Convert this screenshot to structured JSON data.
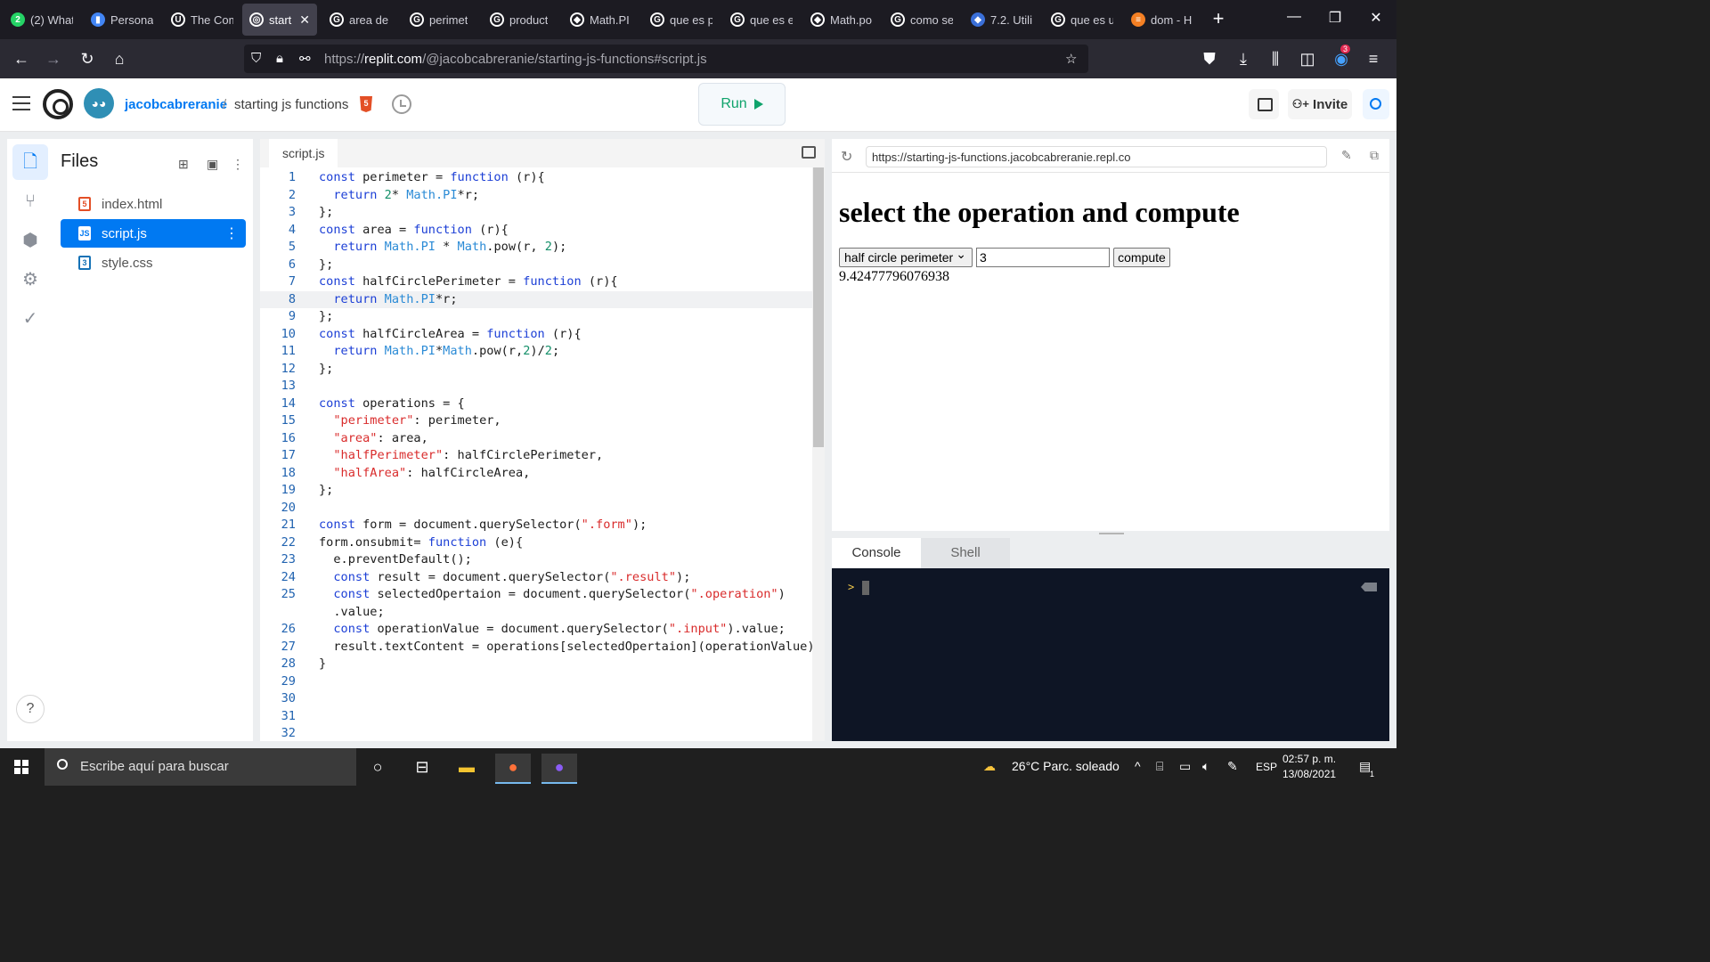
{
  "browser": {
    "tabs": [
      {
        "title": "(2) What",
        "icon": "whatsapp-icon",
        "color": "#25d366",
        "glyph": "2"
      },
      {
        "title": "Personal",
        "icon": "chart-bars-icon",
        "color": "#4285f4",
        "glyph": "▮"
      },
      {
        "title": "The Com",
        "icon": "u-logo-icon",
        "color": "#ffffff",
        "glyph": "U"
      },
      {
        "title": "startin",
        "icon": "replit-icon",
        "color": "#ffffff",
        "glyph": "◎"
      },
      {
        "title": "area de",
        "icon": "google-icon",
        "color": "#ffffff",
        "glyph": "G"
      },
      {
        "title": "perimet",
        "icon": "google-icon",
        "color": "#ffffff",
        "glyph": "G"
      },
      {
        "title": "product",
        "icon": "google-icon",
        "color": "#ffffff",
        "glyph": "G"
      },
      {
        "title": "Math.PI",
        "icon": "mdn-icon",
        "color": "#ffffff",
        "glyph": "◆"
      },
      {
        "title": "que es p",
        "icon": "google-icon",
        "color": "#ffffff",
        "glyph": "G"
      },
      {
        "title": "que es e",
        "icon": "google-icon",
        "color": "#ffffff",
        "glyph": "G"
      },
      {
        "title": "Math.po",
        "icon": "mdn-icon",
        "color": "#ffffff",
        "glyph": "◆"
      },
      {
        "title": "como se",
        "icon": "google-icon",
        "color": "#ffffff",
        "glyph": "G"
      },
      {
        "title": "7.2. Utili",
        "icon": "diamond-icon",
        "color": "#3a6fd8",
        "glyph": "◆"
      },
      {
        "title": "que es u",
        "icon": "google-icon",
        "color": "#ffffff",
        "glyph": "G"
      },
      {
        "title": "dom - H",
        "icon": "stackoverflow-icon",
        "color": "#f48024",
        "glyph": "≡"
      }
    ],
    "url_prefix": "https://",
    "url_host": "replit.com",
    "url_path": "/@jacobcabreranie/starting-js-functions#script.js",
    "notification_count": "3"
  },
  "replit": {
    "username": "jacobcabreranie",
    "separator": "/",
    "repl_name": "starting js functions",
    "run_label": "Run",
    "invite_label": "Invite",
    "files_title": "Files",
    "files": [
      {
        "name": "index.html",
        "type": "html",
        "badge": "5"
      },
      {
        "name": "script.js",
        "type": "js",
        "badge": "JS"
      },
      {
        "name": "style.css",
        "type": "css",
        "badge": "3"
      }
    ],
    "editor_tab": "script.js",
    "help_label": "?"
  },
  "code_lines": [
    {
      "n": "1",
      "html": "<span class=\"k\">const</span> perimeter = <span class=\"k\">function</span> (r){"
    },
    {
      "n": "2",
      "html": "  <span class=\"k\">return</span> <span class=\"n\">2</span>* <span class=\"m\">Math.PI</span>*r;"
    },
    {
      "n": "3",
      "html": "};"
    },
    {
      "n": "4",
      "html": "<span class=\"k\">const</span> area = <span class=\"k\">function</span> (r){"
    },
    {
      "n": "5",
      "html": "  <span class=\"k\">return</span> <span class=\"m\">Math.PI</span> * <span class=\"m\">Math</span>.pow(r, <span class=\"n\">2</span>);"
    },
    {
      "n": "6",
      "html": "};"
    },
    {
      "n": "7",
      "html": "<span class=\"k\">const</span> halfCirclePerimeter = <span class=\"k\">function</span> (r){"
    },
    {
      "n": "8",
      "html": "  <span class=\"k\">return</span> <span class=\"m\">Math.PI</span>*r;"
    },
    {
      "n": "9",
      "html": "};"
    },
    {
      "n": "10",
      "html": "<span class=\"k\">const</span> halfCircleArea = <span class=\"k\">function</span> (r){"
    },
    {
      "n": "11",
      "html": "  <span class=\"k\">return</span> <span class=\"m\">Math.PI</span>*<span class=\"m\">Math</span>.pow(r,<span class=\"n\">2</span>)/<span class=\"n\">2</span>;"
    },
    {
      "n": "12",
      "html": "};"
    },
    {
      "n": "13",
      "html": ""
    },
    {
      "n": "14",
      "html": "<span class=\"k\">const</span> operations = {"
    },
    {
      "n": "15",
      "html": "  <span class=\"s\">\"perimeter\"</span>: perimeter,"
    },
    {
      "n": "16",
      "html": "  <span class=\"s\">\"area\"</span>: area,"
    },
    {
      "n": "17",
      "html": "  <span class=\"s\">\"halfPerimeter\"</span>: halfCirclePerimeter,"
    },
    {
      "n": "18",
      "html": "  <span class=\"s\">\"halfArea\"</span>: halfCircleArea,"
    },
    {
      "n": "19",
      "html": "};"
    },
    {
      "n": "20",
      "html": ""
    },
    {
      "n": "21",
      "html": "<span class=\"k\">const</span> form = document.querySelector(<span class=\"s\">\".form\"</span>);"
    },
    {
      "n": "22",
      "html": "form.onsubmit= <span class=\"k\">function</span> (e){"
    },
    {
      "n": "23",
      "html": "  e.preventDefault();"
    },
    {
      "n": "24",
      "html": "  <span class=\"k\">const</span> result = document.querySelector(<span class=\"s\">\".result\"</span>);"
    },
    {
      "n": "25",
      "html": "  <span class=\"k\">const</span> selectedOpertaion = document.querySelector(<span class=\"s\">\".operation\"</span>)"
    },
    {
      "n": "",
      "html": "  .value;"
    },
    {
      "n": "26",
      "html": "  <span class=\"k\">const</span> operationValue = document.querySelector(<span class=\"s\">\".input\"</span>).value;"
    },
    {
      "n": "27",
      "html": "  result.textContent = operations[selectedOpertaion](operationValue);"
    },
    {
      "n": "28",
      "html": "}"
    },
    {
      "n": "29",
      "html": ""
    },
    {
      "n": "30",
      "html": ""
    },
    {
      "n": "31",
      "html": ""
    },
    {
      "n": "32",
      "html": ""
    }
  ],
  "webview": {
    "url": "https://starting-js-functions.jacobcabreranie.repl.co",
    "heading": "select the operation and compute",
    "select_value": "half circle perimeter",
    "input_value": "3",
    "button_label": "compute",
    "result": "9.42477796076938"
  },
  "console": {
    "tabs": [
      "Console",
      "Shell"
    ],
    "prompt": ">"
  },
  "taskbar": {
    "search_placeholder": "Escribe aquí para buscar",
    "weather": "26°C  Parc. soleado",
    "language": "ESP",
    "time": "02:57 p. m.",
    "date": "13/08/2021",
    "notifications": "1"
  }
}
